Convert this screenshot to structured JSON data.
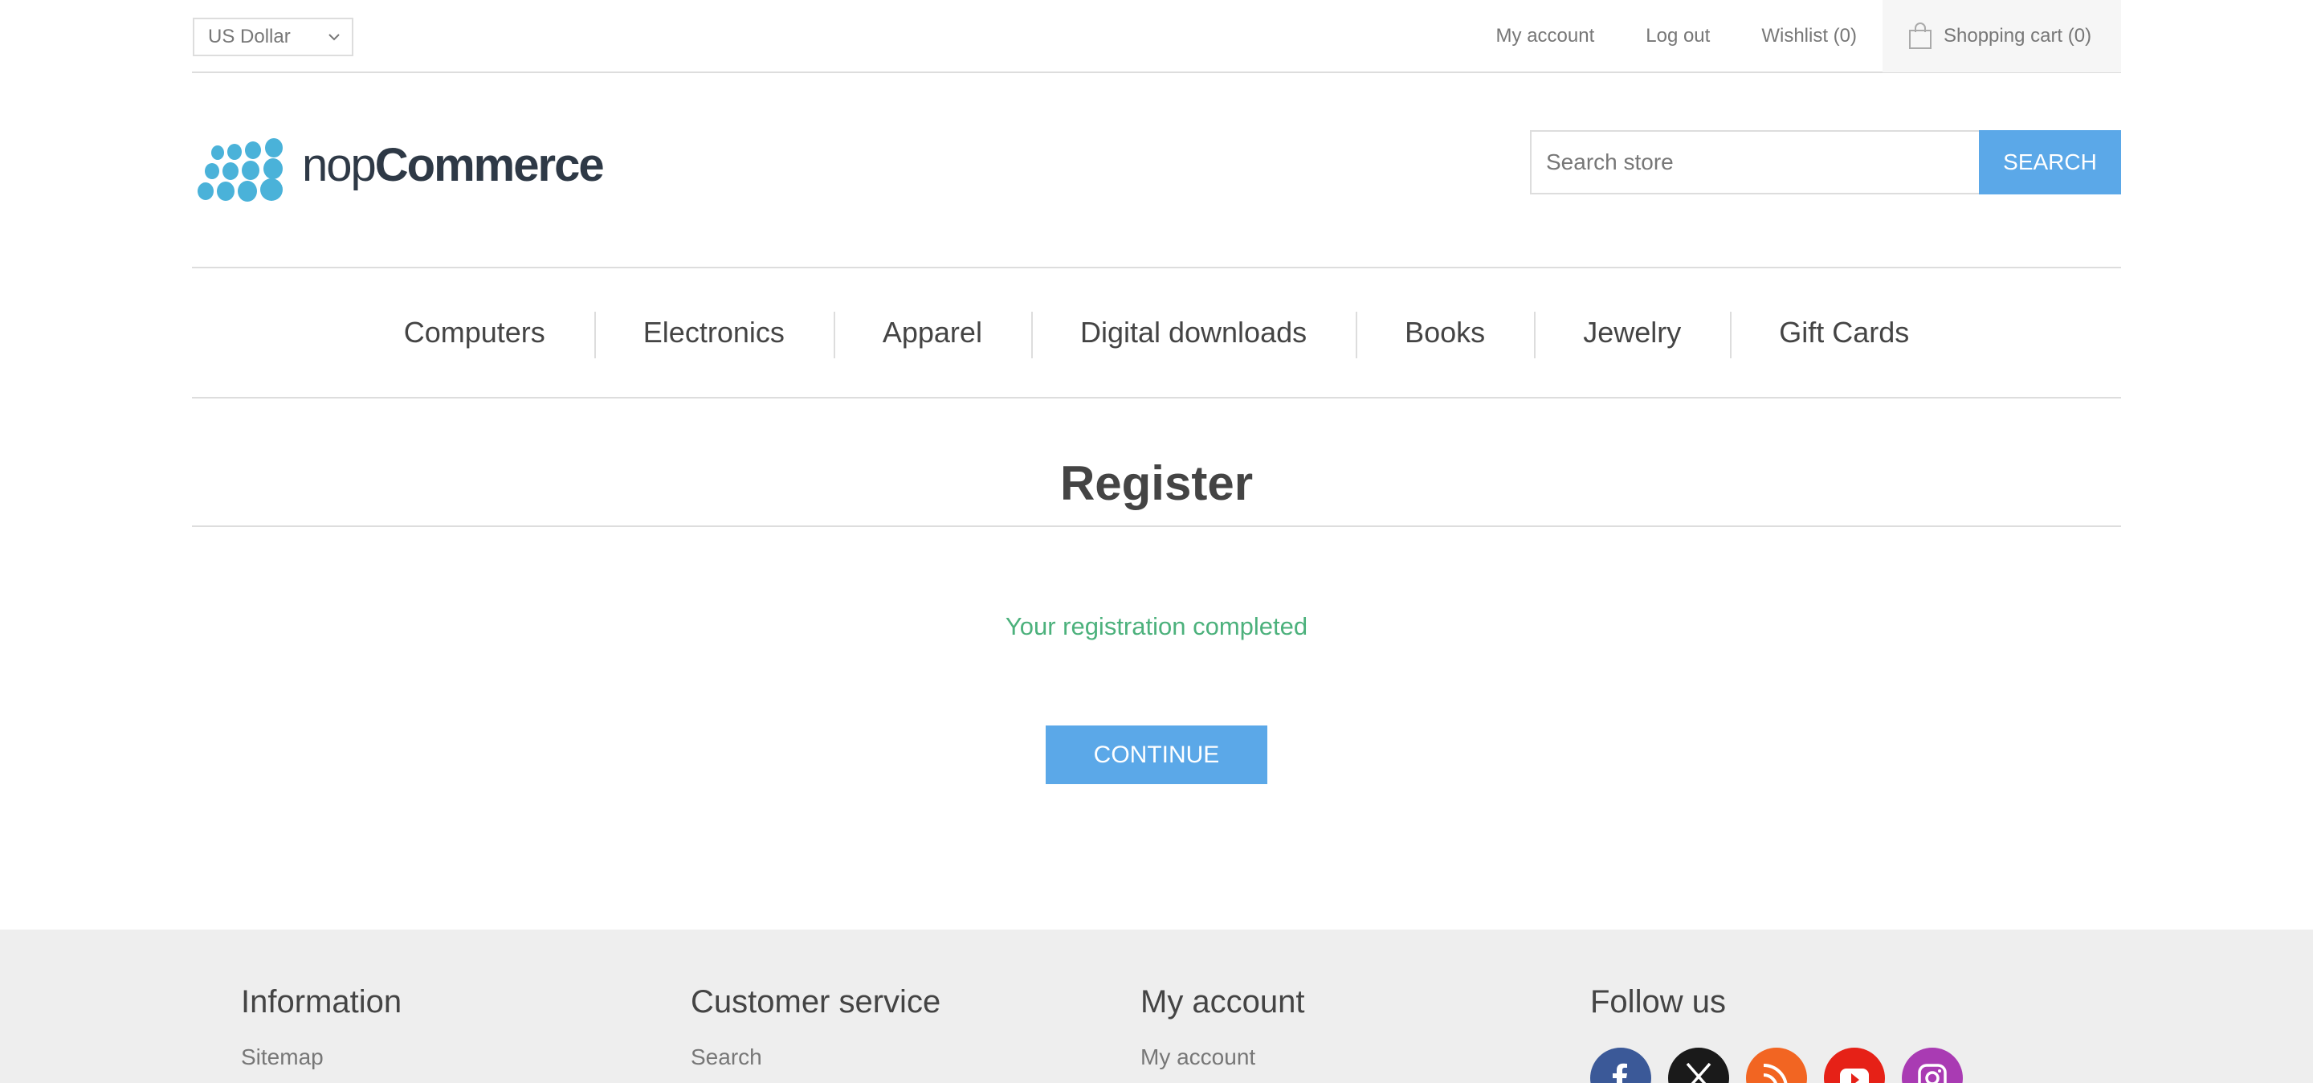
{
  "header": {
    "currency": "US Dollar",
    "links": {
      "my_account": "My account",
      "log_out": "Log out",
      "wishlist": "Wishlist (0)",
      "cart": "Shopping cart (0)"
    }
  },
  "logo": {
    "part1": "nop",
    "part2": "Commerce"
  },
  "search": {
    "placeholder": "Search store",
    "button": "SEARCH"
  },
  "menu": [
    "Computers",
    "Electronics",
    "Apparel",
    "Digital downloads",
    "Books",
    "Jewelry",
    "Gift Cards"
  ],
  "page": {
    "title": "Register",
    "result": "Your registration completed",
    "continue": "CONTINUE"
  },
  "footer": {
    "information": {
      "title": "Information",
      "first_link": "Sitemap"
    },
    "customer_service": {
      "title": "Customer service",
      "first_link": "Search"
    },
    "my_account": {
      "title": "My account",
      "first_link": "My account"
    },
    "follow_us": {
      "title": "Follow us"
    }
  },
  "colors": {
    "accent": "#5ba8e8",
    "success": "#4cb17c",
    "logo_dots": "#4ab2d9",
    "facebook": "#3b5998",
    "x": "#1a1a1a",
    "rss": "#f26522",
    "youtube": "#e62117",
    "instagram": "#a93bb3"
  },
  "icons": [
    "chevron-down-icon",
    "cart-bag-icon",
    "facebook-icon",
    "x-icon",
    "rss-icon",
    "youtube-icon",
    "instagram-icon"
  ]
}
